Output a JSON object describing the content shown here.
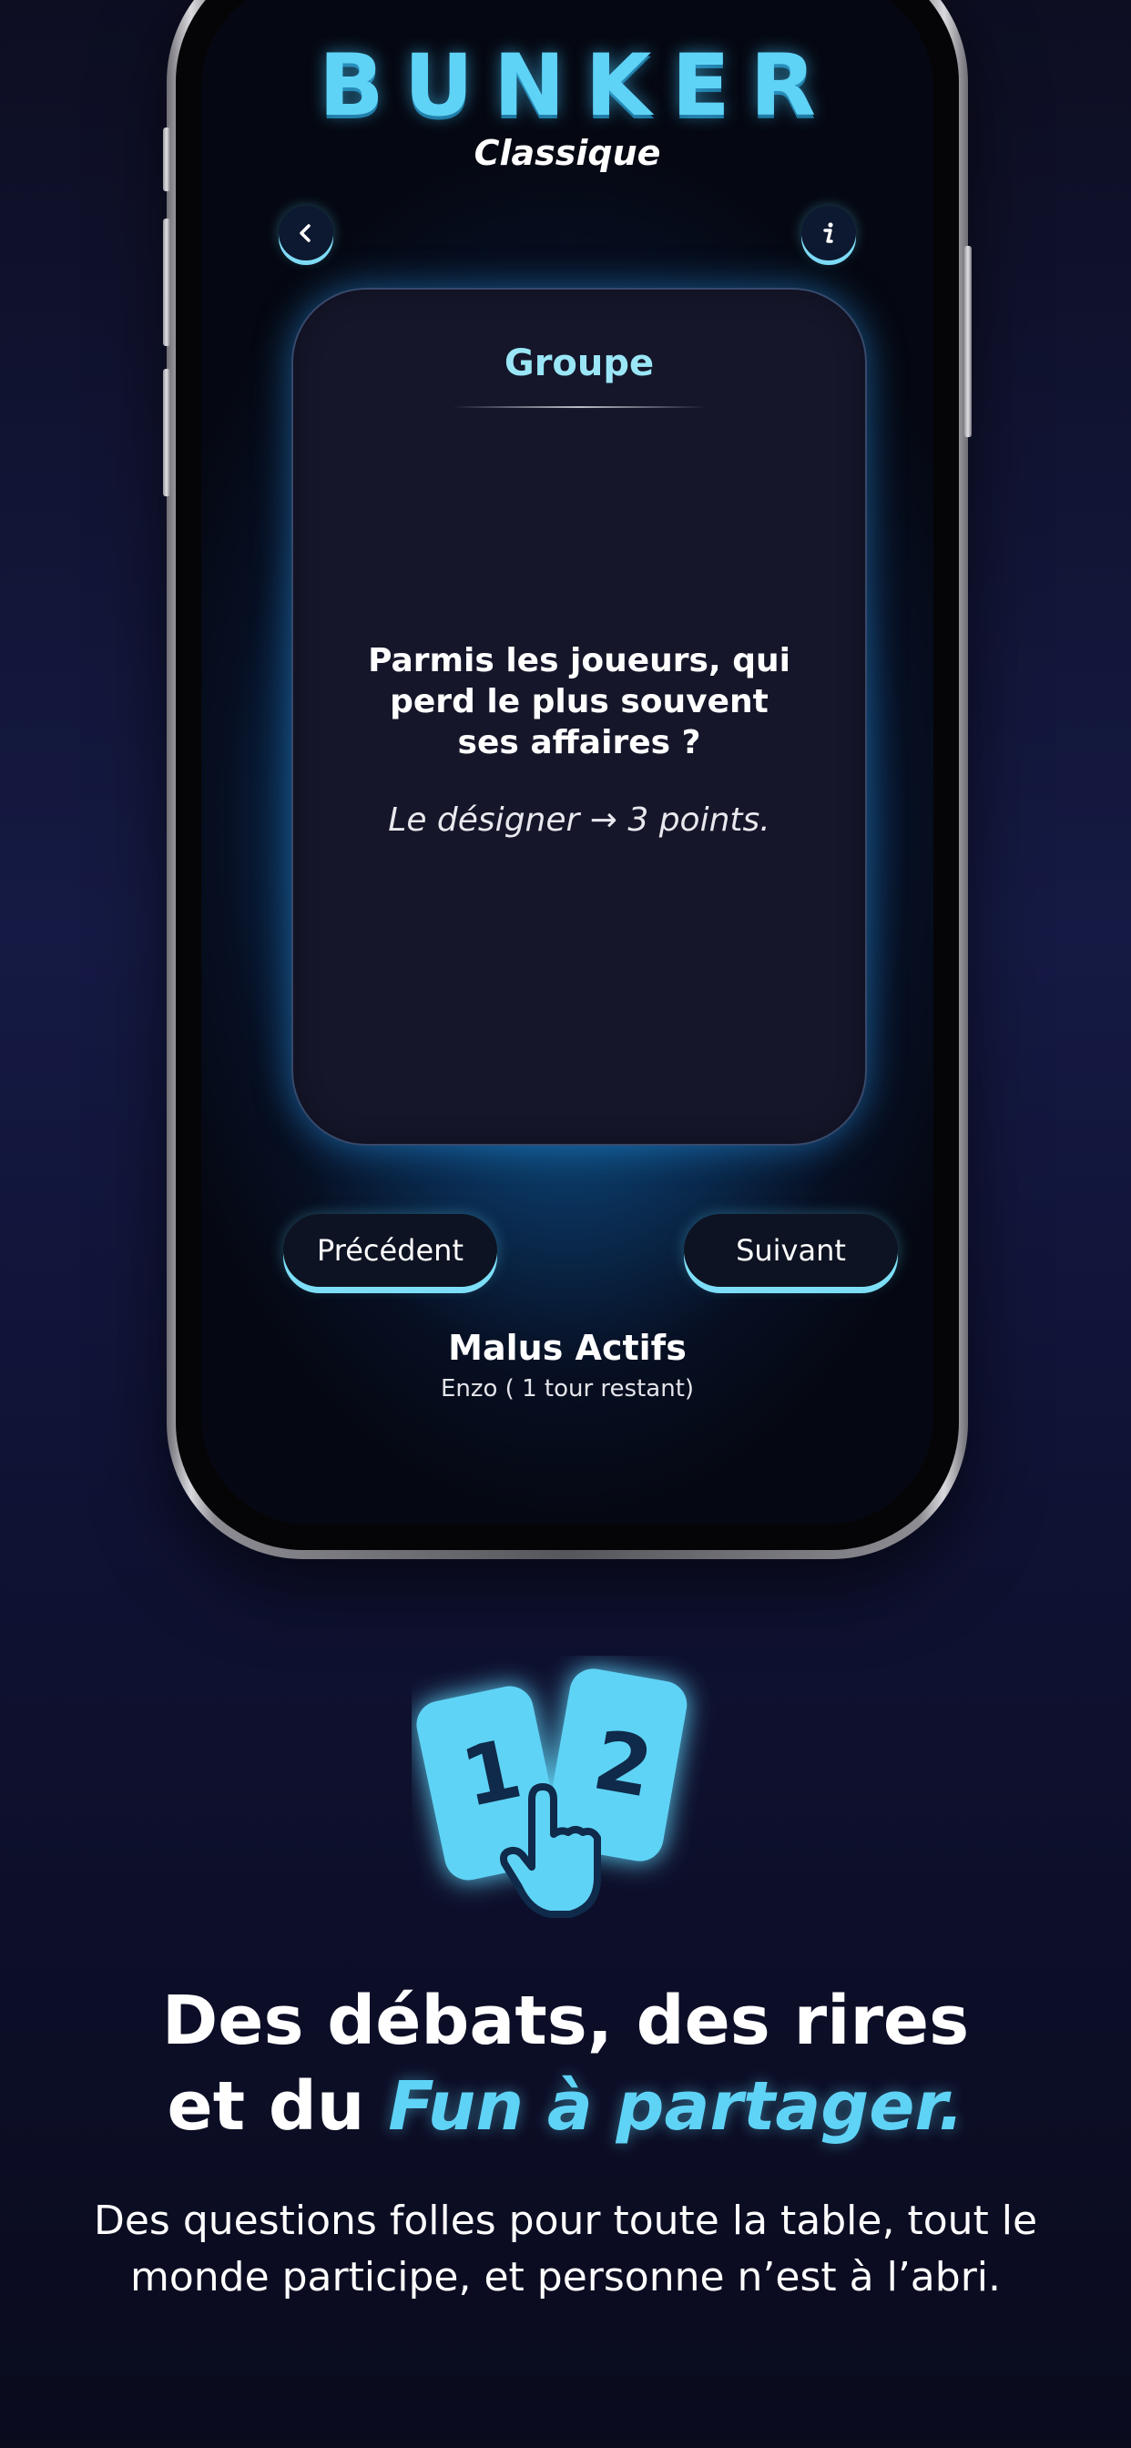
{
  "app": {
    "title": "BUNKER",
    "mode": "Classique"
  },
  "card": {
    "category": "Groupe",
    "question": "Parmis les joueurs, qui perd le plus souvent ses affaires ?",
    "rule": "Le désigner → 3 points."
  },
  "nav": {
    "previous_label": "Précédent",
    "next_label": "Suivant"
  },
  "malus": {
    "title": "Malus Actifs",
    "detail": "Enzo ( 1 tour restant)"
  },
  "promo": {
    "logo_card_1": "1",
    "logo_card_2": "2",
    "headline_line1": "Des débats, des rires",
    "headline_line2_prefix": "et du ",
    "headline_accent": "Fun à partager.",
    "description": "Des questions folles pour toute la table, tout le monde participe, et personne n’est à l’abri."
  },
  "colors": {
    "accent": "#5fd3f6",
    "background": "#111436",
    "card_background": "#15162a"
  },
  "icons": {
    "back": "chevron-left-icon",
    "info": "info-icon",
    "logo": "numbered-cards-tap-icon"
  }
}
